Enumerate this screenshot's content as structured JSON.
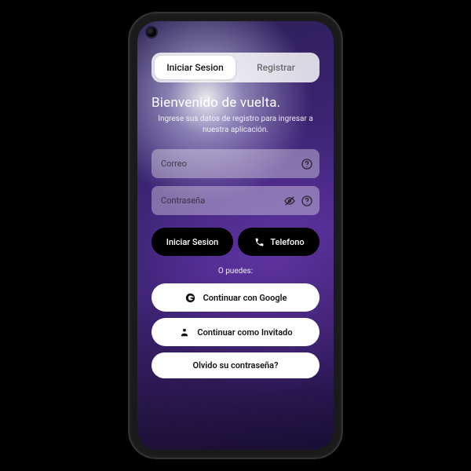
{
  "tabs": {
    "login": "Iniciar Sesion",
    "register": "Registrar"
  },
  "heading": "Bienvenido de vuelta.",
  "subheading": "Ingrese sus datos de registro para ingresar a nuestra aplicación.",
  "fields": {
    "email_placeholder": "Correo",
    "password_placeholder": "Contraseña"
  },
  "buttons": {
    "login": "Iniciar Sesion",
    "phone": "Telefono",
    "divider": "O puedes:",
    "google": "Continuar con Google",
    "guest": "Continuar como Invitado",
    "forgot": "Olvido su contraseña?"
  }
}
